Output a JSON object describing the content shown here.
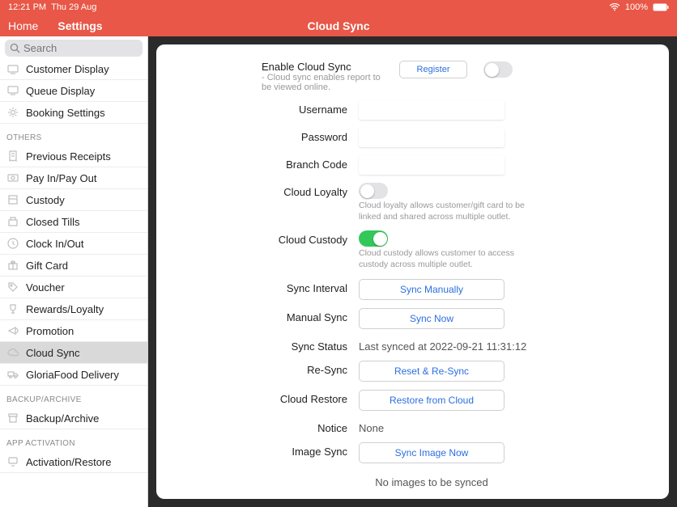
{
  "status": {
    "time": "12:21 PM",
    "date": "Thu 29 Aug",
    "battery": "100%"
  },
  "header": {
    "home": "Home",
    "settings": "Settings",
    "title": "Cloud Sync"
  },
  "search": {
    "placeholder": "Search"
  },
  "sidebar": {
    "top": [
      {
        "label": "Customer Display",
        "icon": "monitor"
      },
      {
        "label": "Queue Display",
        "icon": "monitor"
      },
      {
        "label": "Booking Settings",
        "icon": "gear"
      }
    ],
    "others_header": "OTHERS",
    "others": [
      {
        "label": "Previous Receipts",
        "icon": "receipt"
      },
      {
        "label": "Pay In/Pay Out",
        "icon": "cash"
      },
      {
        "label": "Custody",
        "icon": "box"
      },
      {
        "label": "Closed Tills",
        "icon": "till"
      },
      {
        "label": "Clock In/Out",
        "icon": "clock"
      },
      {
        "label": "Gift Card",
        "icon": "gift"
      },
      {
        "label": "Voucher",
        "icon": "tag"
      },
      {
        "label": "Rewards/Loyalty",
        "icon": "trophy"
      },
      {
        "label": "Promotion",
        "icon": "horn"
      },
      {
        "label": "Cloud Sync",
        "icon": "cloud",
        "selected": true
      },
      {
        "label": "GloriaFood Delivery",
        "icon": "truck"
      }
    ],
    "backup_header": "BACKUP/ARCHIVE",
    "backup": [
      {
        "label": "Backup/Archive",
        "icon": "archive"
      }
    ],
    "activation_header": "APP ACTIVATION",
    "activation": [
      {
        "label": "Activation/Restore",
        "icon": "device"
      }
    ]
  },
  "form": {
    "enable": {
      "label": "Enable Cloud Sync",
      "desc": "- Cloud sync enables report to be viewed online.",
      "register": "Register"
    },
    "username": {
      "label": "Username"
    },
    "password": {
      "label": "Password"
    },
    "branch": {
      "label": "Branch Code"
    },
    "loyalty": {
      "label": "Cloud Loyalty",
      "desc": "Cloud loyalty allows customer/gift card to be linked and shared across multiple outlet."
    },
    "custody": {
      "label": "Cloud Custody",
      "desc": "Cloud custody allows customer to access custody across multiple outlet."
    },
    "interval": {
      "label": "Sync Interval",
      "btn": "Sync Manually"
    },
    "manual": {
      "label": "Manual Sync",
      "btn": "Sync Now"
    },
    "status": {
      "label": "Sync Status",
      "value": "Last synced at 2022-09-21 11:31:12"
    },
    "resync": {
      "label": "Re-Sync",
      "btn": "Reset & Re-Sync"
    },
    "restore": {
      "label": "Cloud Restore",
      "btn": "Restore from Cloud"
    },
    "notice": {
      "label": "Notice",
      "value": "None"
    },
    "image": {
      "label": "Image Sync",
      "btn": "Sync Image Now",
      "status": "No images to be synced"
    }
  }
}
